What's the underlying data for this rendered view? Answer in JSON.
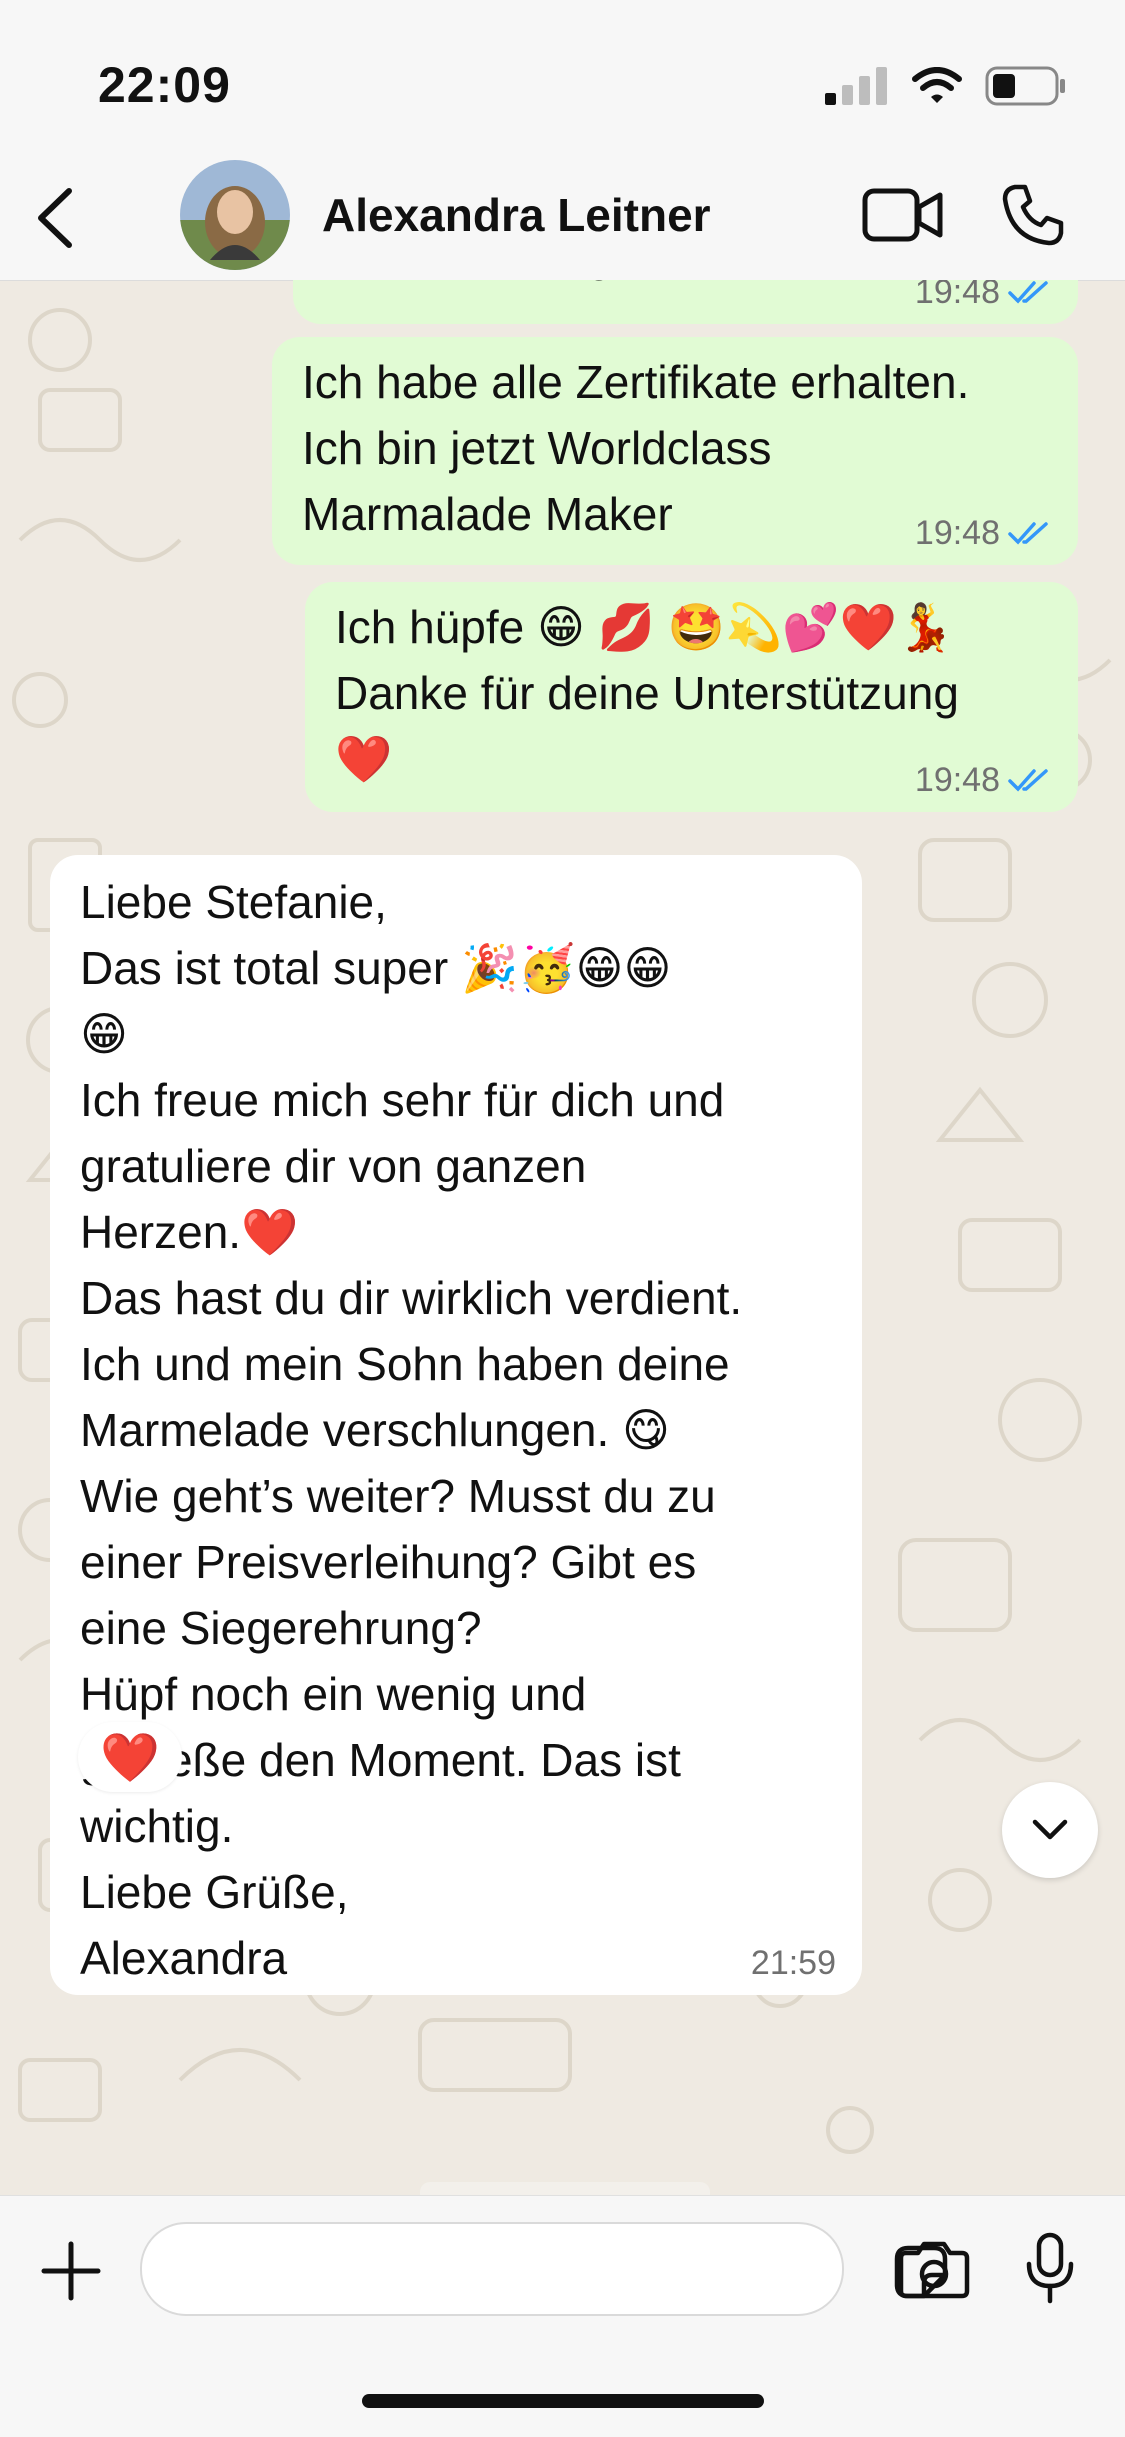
{
  "status_bar": {
    "time": "22:09"
  },
  "header": {
    "contact_name": "Alexandra Leitner",
    "icons": [
      "back-chevron-icon",
      "video-camera-icon",
      "phone-icon"
    ]
  },
  "messages": [
    {
      "direction": "outgoing",
      "text": "Auszeichnung",
      "time": "19:48",
      "read": true
    },
    {
      "direction": "outgoing",
      "text": "Ich habe alle Zertifikate erhalten.\nIch bin jetzt Worldclass\nMarmalade Maker",
      "time": "19:48",
      "read": true
    },
    {
      "direction": "outgoing",
      "text": "Ich hüpfe 😁 💋 🤩💫💕❤️💃\nDanke für deine Unterstützung\n❤️",
      "time": "19:48",
      "read": true
    },
    {
      "direction": "incoming",
      "text": "Liebe Stefanie,\nDas ist total super 🎉🥳😁😁\n😁\nIch freue mich sehr für dich und\ngratuliere dir von ganzen\nHerzen.❤️\nDas hast du dir wirklich verdient.\nIch und mein Sohn haben deine\nMarmelade verschlungen. 😋\nWie geht’s weiter? Musst du zu\neiner Preisverleihung? Gibt es\neine Siegerehrung?\nHüpf noch ein wenig und\ngenieße den Moment. Das ist\nwichtig.\nLiebe Grüße,\nAlexandra",
      "time": "21:59",
      "reaction": "❤️"
    }
  ],
  "input_bar": {
    "placeholder": "",
    "icons": [
      "plus-icon",
      "sticker-icon",
      "camera-icon",
      "microphone-icon"
    ]
  },
  "colors": {
    "outgoing_bubble": "#e1fbd4",
    "incoming_bubble": "#ffffff",
    "wallpaper": "#efeae2",
    "read_ticks": "#3497f9",
    "bar": "#f7f7f7"
  }
}
